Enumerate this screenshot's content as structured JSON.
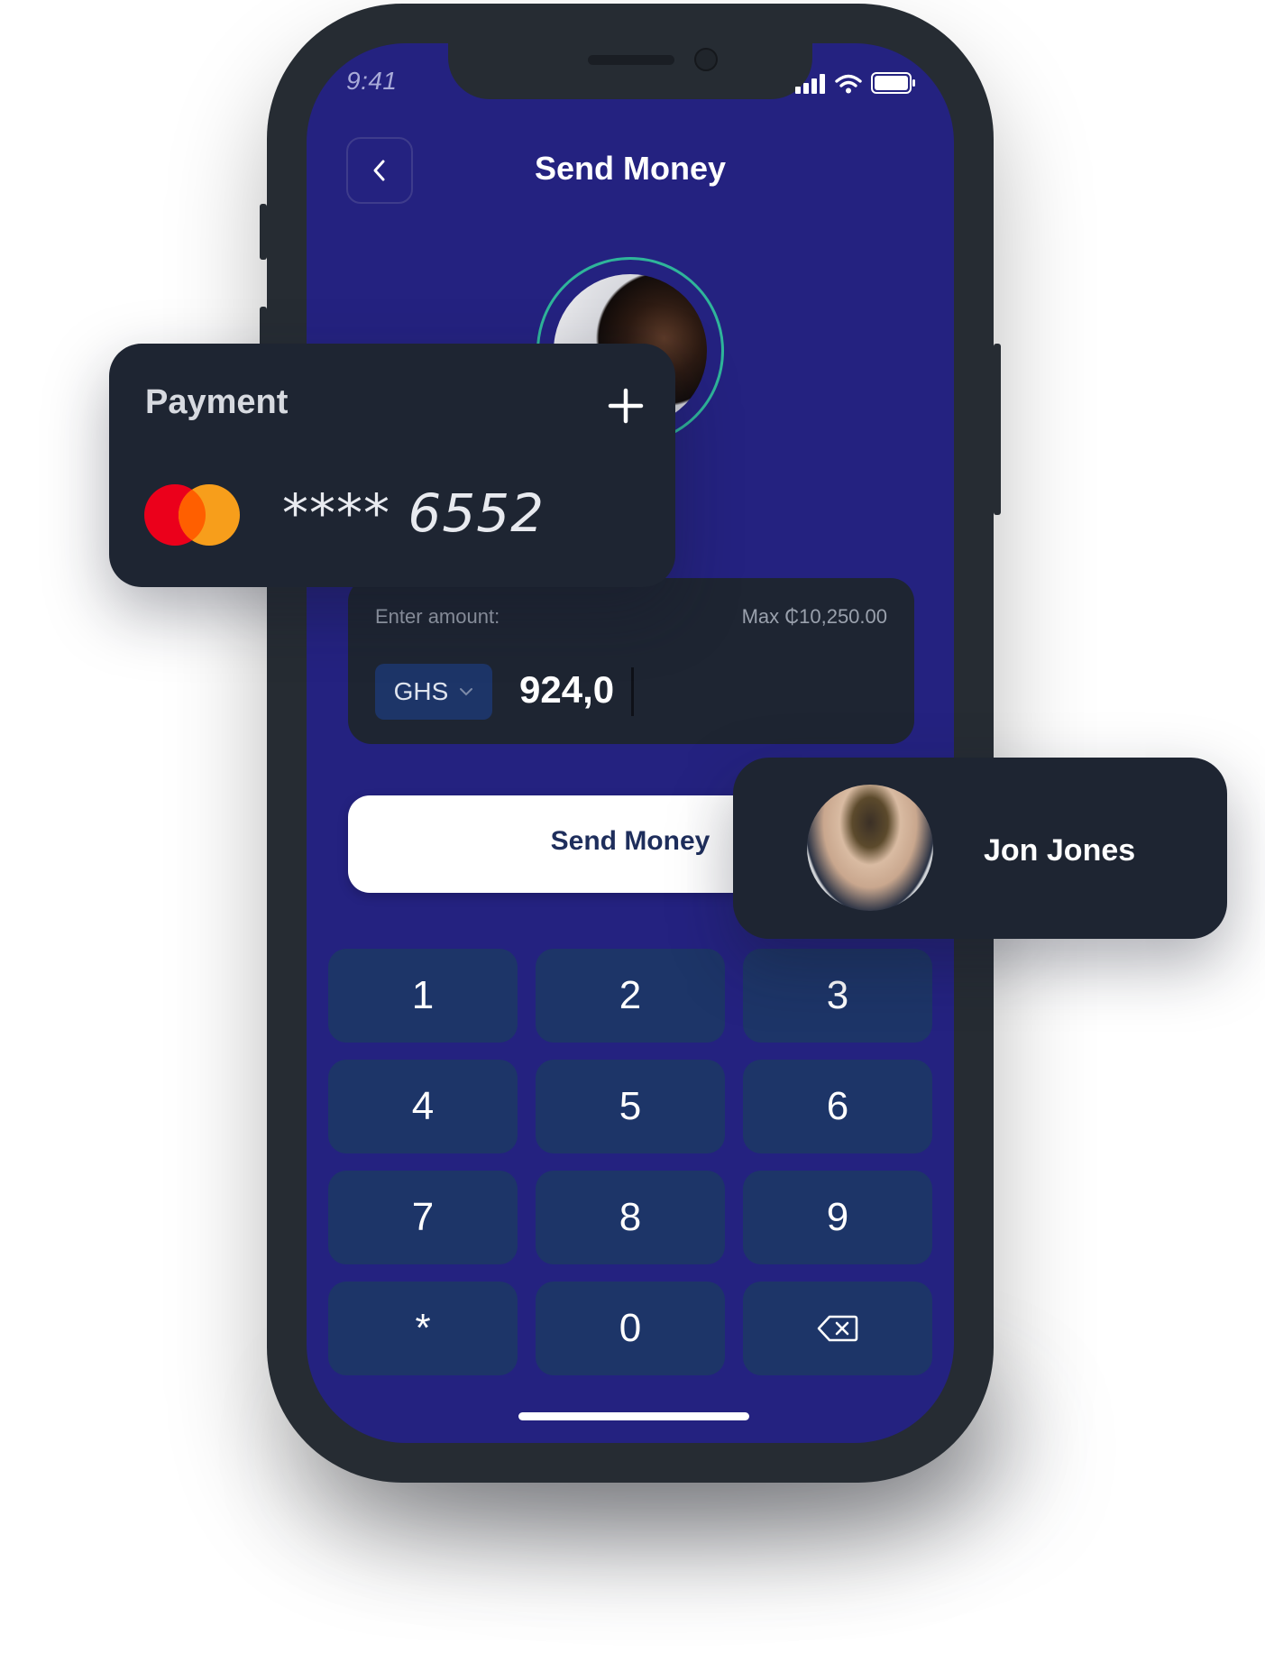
{
  "status_bar": {
    "time": "9:41"
  },
  "header": {
    "title": "Send Money"
  },
  "amount": {
    "label": "Enter amount:",
    "max": "Max ₵10,250.00",
    "currency": "GHS",
    "value": "924,0"
  },
  "send_button": {
    "label": "Send Money"
  },
  "keypad": {
    "keys": [
      "1",
      "2",
      "3",
      "4",
      "5",
      "6",
      "7",
      "8",
      "9",
      "*",
      "0"
    ]
  },
  "payment": {
    "title": "Payment",
    "card_number": "**** 6552"
  },
  "contact": {
    "name": "Jon Jones"
  },
  "colors": {
    "screen_bg": "#242280",
    "card_bg": "#1e2532",
    "key_bg": "#1d3568",
    "avatar_ring": "#2fb59a",
    "mastercard_red": "#eb001b",
    "mastercard_orange": "#f79e1b"
  },
  "icons": [
    "back-chevron-icon",
    "signal-icon",
    "wifi-icon",
    "battery-icon",
    "plus-icon",
    "mastercard-icon",
    "chevron-down-icon",
    "backspace-icon"
  ]
}
